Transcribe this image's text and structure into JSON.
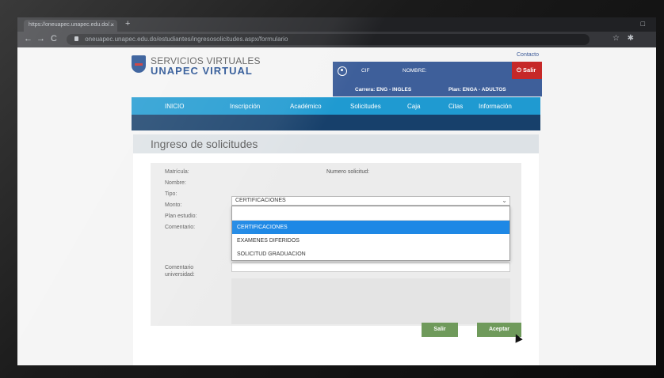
{
  "browser": {
    "tab_title": "https://oneuapec.unapec.edu.do/...",
    "tab_close": "×",
    "newtab": "+",
    "window_controls": "□",
    "back": "←",
    "forward": "→",
    "reload": "C",
    "url": "oneuapec.unapec.edu.do/estudiantes/ingresosolicitudes.aspx/formulario",
    "star": "☆",
    "extension": "✱"
  },
  "header": {
    "logo_top": "SERVICIOS VIRTUALES",
    "logo_bottom": "UNAPEC VIRTUAL",
    "contacto": "Contacto",
    "user_label_id": "CIF",
    "user_label_name": "NOMBRE:",
    "carrera": "Carrera: ENG - INGLES",
    "plan": "Plan: ENGA - ADULTOS",
    "salir": "Salir"
  },
  "nav": {
    "items": [
      "INICIO",
      "Inscripción",
      "Académico",
      "Solicitudes",
      "Caja",
      "Citas",
      "Información"
    ]
  },
  "page": {
    "title": "Ingreso de solicitudes"
  },
  "form": {
    "matricula_label": "Matrícula:",
    "numero_label": "Numero solicitud:",
    "nombre_label": "Nombre:",
    "tipo_label": "Tipo:",
    "monto_label": "Monto:",
    "plan_label": "Plan estudio:",
    "comentario_label": "Comentario:",
    "comentario_univ_label": "Comentario universidad:",
    "tipo_value": "CERTIFICACIONES",
    "chevron": "⌄",
    "options": [
      "CERTIFICACIONES",
      "EXAMENES DIFERIDOS",
      "SOLICITUD GRADUACION"
    ],
    "selected_index": 0
  },
  "actions": {
    "salir": "Salir",
    "aceptar": "Aceptar"
  },
  "colors": {
    "nav_blue": "#1f9ad1",
    "dark_blue": "#17406b",
    "user_box": "#3e5f9a",
    "red": "#c62828",
    "button_green": "#6f9a5b",
    "option_selected": "#1e88e5"
  }
}
